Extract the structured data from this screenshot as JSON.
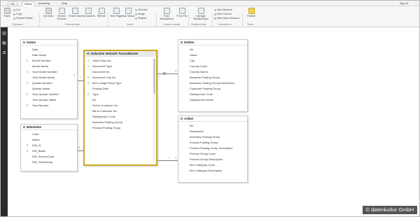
{
  "titlebar": {
    "file_label": "File",
    "tabs": [
      "Home",
      "Modeling",
      "Help"
    ],
    "sign_in": "Sign in",
    "window_caret": "^"
  },
  "ribbon": {
    "paste": "Paste",
    "cut": "Cut",
    "copy": "Copy",
    "format_painter": "Format Painter",
    "get_data": "Get Data",
    "recent_sources": "Recent Sources",
    "enter_data": "Enter Data",
    "edit_queries": "Edit Queries",
    "refresh": "Refresh",
    "new_page": "New Page",
    "new_visual": "New Visual",
    "text_box": "Text Box",
    "image": "Image",
    "shapes": "Shapes",
    "from_marketplace": "From Marketplace",
    "from_file": "From File",
    "manage_relationships": "Manage Relationships",
    "new_measure": "New Measure",
    "new_column": "New Column",
    "new_quick_measure": "New Quick Measure",
    "publish": "Publish",
    "groups": [
      "Clipboard",
      "External data",
      "Insert",
      "Custom visuals",
      "Relationships",
      "Calculations",
      "Share"
    ]
  },
  "nav": {
    "icons": [
      "report-icon",
      "data-icon",
      "relationships-icon"
    ]
  },
  "tables": {
    "datum": {
      "name": "Datum",
      "fields": [
        "Date",
        "Date Name",
        "Month Number",
        "Month Name",
        "Year Month Number",
        "Year Month Name",
        "Quarter Number",
        "Quarter Name",
        "Year Quarter Number",
        "Year Quarter Name",
        "Year Number"
      ],
      "summed": [
        false,
        false,
        true,
        false,
        true,
        false,
        true,
        false,
        true,
        false,
        true
      ]
    },
    "mitarbeiter": {
      "name": "Mitarbeiter",
      "fields": [
        "Code",
        "Name",
        "DW_Id",
        "DW_Batch",
        "DW_SourceCode",
        "DW_TimeStamp"
      ],
      "summed": [
        false,
        false,
        true,
        true,
        false,
        false
      ]
    },
    "gebuchte": {
      "name": "Gebuchte Verkaufs Transaktionen",
      "fields": [
        "Value Entry No",
        "Document Type",
        "Document No",
        "Document Line No",
        "Item Ledger Entry Type",
        "Posting Date",
        "Type",
        "No",
        "Sell-to Customer No",
        "Bill-to Customer No",
        "Salesperson Code",
        "Business Posting Group",
        "Product Posting Group"
      ],
      "summed": [
        true,
        true,
        false,
        true,
        true,
        false,
        true,
        false,
        false,
        false,
        false,
        false,
        false
      ]
    },
    "debitor": {
      "name": "Debitor",
      "fields": [
        "No",
        "Name",
        "City",
        "Country Code",
        "Country Name",
        "Business Posting Group",
        "Business Posting Group Description",
        "Customer Posting Group",
        "Salesperson Code",
        "Salesperson Name"
      ]
    },
    "artikel": {
      "name": "Artikel",
      "fields": [
        "No",
        "Description",
        "Inventory Posting Group",
        "Product Posting Group",
        "Product Posting Group Description",
        "Product Group Code",
        "Product Group Description",
        "Item Category Code",
        "Item Category Description"
      ]
    }
  },
  "relationships": {
    "one": "1",
    "many": "*"
  },
  "watermark": "© datenkultur GmbH"
}
